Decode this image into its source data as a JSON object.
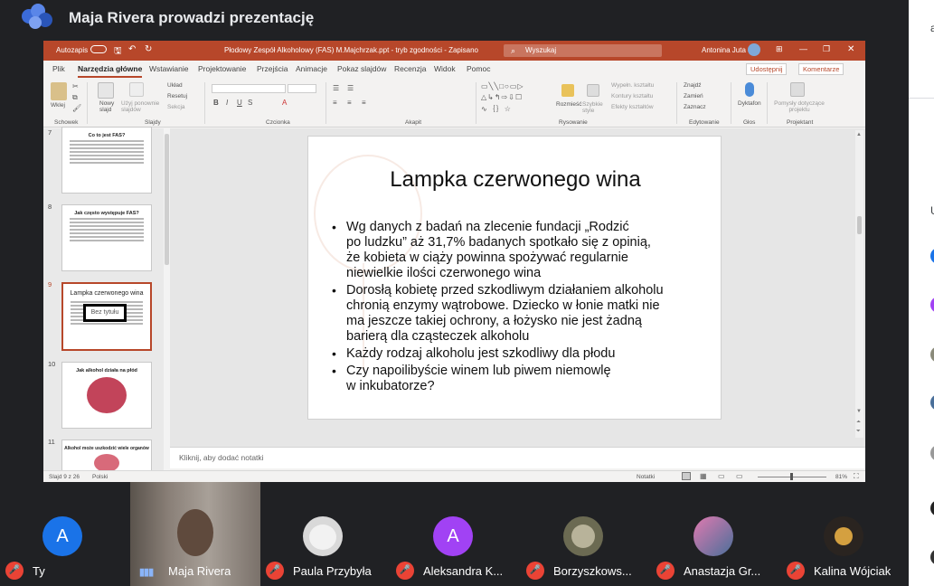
{
  "meet": {
    "presenter_title": "Maja Rivera prowadzi prezentację",
    "side_panel_char": "a",
    "side_panel_letter_u": "U"
  },
  "ppt": {
    "titlebar": {
      "autosave": "Autozapis",
      "filename": "Płodowy Zespół Alkoholowy (FAS) M.Majchrzak.ppt  -  tryb zgodności  -  Zapisano",
      "search": "Wyszukaj",
      "user": "Antonina Juta"
    },
    "tabs": [
      "Plik",
      "Narzędzia główne",
      "Wstawianie",
      "Projektowanie",
      "Przejścia",
      "Animacje",
      "Pokaz slajdów",
      "Recenzja",
      "Widok",
      "Pomoc"
    ],
    "share": "Udostępnij",
    "comments": "Komentarze",
    "ribbon": {
      "paste": "Wklej",
      "clipboard": "Schowek",
      "new_slide": "Nowy slajd",
      "reuse": "Użyj ponownie slajdów",
      "layout": "Układ",
      "reset": "Resetuj",
      "section": "Sekcja",
      "slides": "Slajdy",
      "font": "Czcionka",
      "paragraph": "Akapit",
      "arrange": "Rozmieść",
      "quick_styles": "Szybkie style",
      "shape_fill": "Wypełn. kształtu",
      "shape_outline": "Kontury kształtu",
      "shape_effects": "Efekty kształtów",
      "drawing": "Rysowanie",
      "find": "Znajdź",
      "replace": "Zamień",
      "select": "Zaznacz",
      "editing": "Edytowanie",
      "dictate": "Dyktafon",
      "voice": "Głos",
      "designer": "Pomysły dotyczące projektu",
      "designer_group": "Projektant"
    },
    "thumbnails": [
      {
        "num": "7",
        "title": "Co to jest FAS?"
      },
      {
        "num": "8",
        "title": "Jak często występuje FAS?"
      },
      {
        "num": "9",
        "title": "Lampka czerwonego wina",
        "tooltip": "Bez tytułu"
      },
      {
        "num": "10",
        "title": "Jak alkohol działa na płód"
      },
      {
        "num": "11",
        "title": "Alkohol może uszkodzić wiele organów"
      }
    ],
    "slide": {
      "title": "Lampka czerwonego wina",
      "bullets": [
        "Wg danych z badań na zlecenie fundacji „Rodzić\npo ludzku” aż 31,7% badanych spotkało się z opinią,\nże kobieta w ciąży powinna spożywać regularnie\nniewielkie ilości czerwonego wina",
        "Dorosłą kobietę przed szkodliwym działaniem alkoholu\nchronią enzymy wątrobowe. Dziecko w łonie matki nie\nma jeszcze takiej ochrony, a łożysko nie jest żadną\nbarierą dla cząsteczek alkoholu",
        "Każdy rodzaj alkoholu jest szkodliwy dla płodu",
        "Czy napoilibyście winem lub piwem niemowlę\nw inkubatorze?"
      ]
    },
    "notes_placeholder": "Kliknij, aby dodać notatki",
    "status": {
      "slide_count": "Slajd 9 z 26",
      "language": "Polski",
      "notes": "Notatki",
      "zoom": "81%"
    }
  },
  "participants": [
    {
      "name": "Ty",
      "initial": "A",
      "color": "#1a73e8"
    },
    {
      "name": "Maja Rivera"
    },
    {
      "name": "Paula Przybyła",
      "color": "#cfcfcf"
    },
    {
      "name": "Aleksandra K...",
      "initial": "A",
      "color": "#a142f4"
    },
    {
      "name": "Borzyszkows...",
      "color": "#6b6a52"
    },
    {
      "name": "Anastazja Gr...",
      "color": "#4a6f9a"
    },
    {
      "name": "Kalina Wójciak",
      "color": "#2a2420"
    }
  ]
}
